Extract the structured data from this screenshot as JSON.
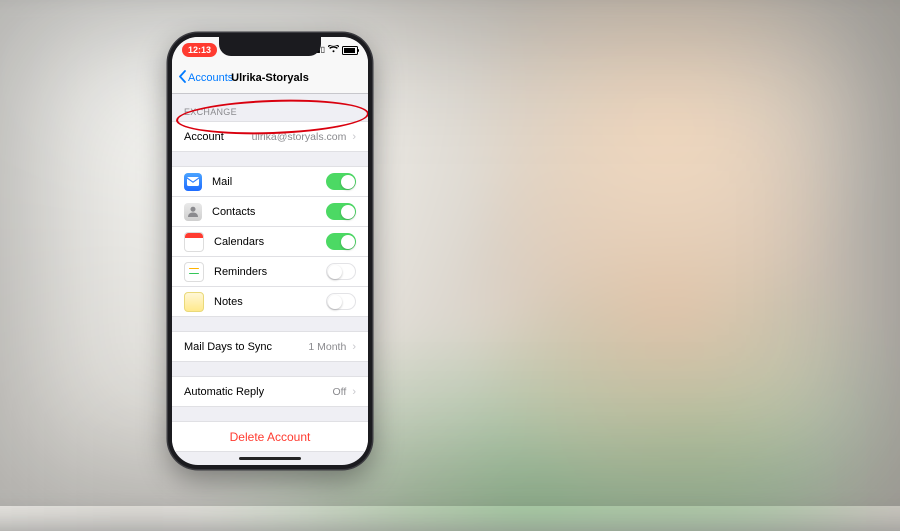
{
  "status": {
    "time": "12:13",
    "signal_icon": "signal-icon",
    "wifi_icon": "wifi-icon",
    "battery_icon": "battery-icon"
  },
  "nav": {
    "back_label": "Accounts",
    "title": "Ulrika-Storyals"
  },
  "section_exchange_header": "EXCHANGE",
  "account": {
    "label": "Account",
    "value": "ulrika@storyals.com"
  },
  "services": [
    {
      "name": "Mail",
      "icon": "mail-icon",
      "enabled": true
    },
    {
      "name": "Contacts",
      "icon": "contacts-icon",
      "enabled": true
    },
    {
      "name": "Calendars",
      "icon": "calendars-icon",
      "enabled": true
    },
    {
      "name": "Reminders",
      "icon": "reminders-icon",
      "enabled": false
    },
    {
      "name": "Notes",
      "icon": "notes-icon",
      "enabled": false
    }
  ],
  "mail_sync": {
    "label": "Mail Days to Sync",
    "value": "1 Month"
  },
  "auto_reply": {
    "label": "Automatic Reply",
    "value": "Off"
  },
  "delete_label": "Delete Account",
  "annotation": {
    "highlight": "account-row"
  },
  "colors": {
    "ios_blue": "#007aff",
    "ios_green": "#4cd964",
    "ios_red": "#ff3b30"
  }
}
